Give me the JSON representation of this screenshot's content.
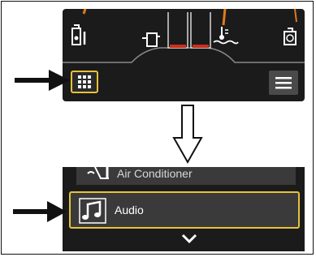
{
  "top_panel": {
    "icons": [
      "fuel-filter-icon",
      "fuel-tank-icon",
      "gauge-bars",
      "coolant-temp-icon",
      "oil-can-icon"
    ],
    "grid_button_icon": "grid-icon",
    "menu_button_icon": "hamburger-menu-icon"
  },
  "bottom_panel": {
    "items": [
      {
        "label": "Air Conditioner",
        "icon": "air-conditioner-icon"
      },
      {
        "label": "Audio",
        "icon": "music-note-icon"
      }
    ],
    "scroll_icon": "chevron-down-icon"
  },
  "colors": {
    "highlight": "#e8c23a",
    "gauge_red": "#c8321e",
    "needle": "#e07a1a",
    "panel_bg": "#1b1b1b"
  }
}
